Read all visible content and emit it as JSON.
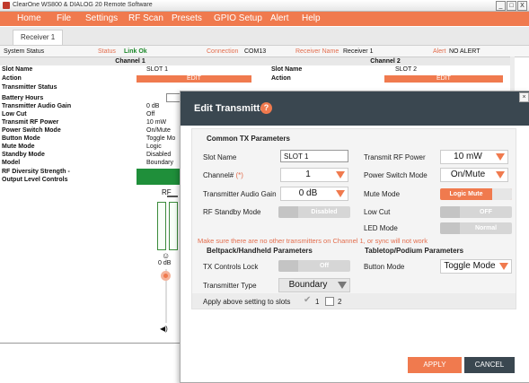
{
  "window": {
    "title": "ClearOne WS800 & DIALOG 20 Remote Software",
    "minimize": "_",
    "maximize": "□",
    "close": "X"
  },
  "menu": [
    "Home",
    "File",
    "Settings",
    "RF Scan",
    "Presets",
    "GPIO Setup",
    "Alert",
    "Help"
  ],
  "tab": "Receiver 1",
  "status": {
    "system_label": "System Status",
    "status_label": "Status",
    "status_value": "Link Ok",
    "connection_label": "Connection",
    "connection_value": "COM13",
    "receiver_name_label": "Receiver Name",
    "receiver_name_value": "Receiver 1",
    "alert_label": "Alert",
    "alert_value": "NO ALERT"
  },
  "channels": {
    "ch1": "Channel 1",
    "ch2": "Channel 2",
    "slot_name_label": "Slot Name",
    "action_label": "Action",
    "ch1_slot": "SLOT 1",
    "ch2_slot": "SLOT 2",
    "edit": "EDIT",
    "rows": [
      "Slot Name",
      "Action",
      "Transmitter Status",
      "Battery Hours",
      "Transmitter Audio Gain",
      "Low Cut",
      "Transmit RF Power",
      "Power Switch Mode",
      "Button Mode",
      "Mute Mode",
      "Standby Mode",
      "Model",
      "RF Diversity Strength -",
      "Output Level Controls"
    ],
    "values": [
      "0 dB",
      "Off",
      "10 mW",
      "On/Mute",
      "Toggle Mo",
      "Logic",
      "Disabled",
      "Boundary"
    ],
    "rf_label": "RF",
    "odb_label": "0 dB"
  },
  "dialog": {
    "title": "Edit Transmitter",
    "help": "?",
    "close": "×",
    "common_header": "Common TX Parameters",
    "slot_name_label": "Slot Name",
    "slot_name_value": "SLOT 1",
    "channel_label": "Channel#",
    "channel_required": "(*)",
    "channel_value": "1",
    "audio_gain_label": "Transmitter Audio Gain",
    "audio_gain_value": "0 dB",
    "rf_standby_label": "RF Standby Mode",
    "rf_standby_value": "Disabled",
    "rf_power_label": "Transmit RF Power",
    "rf_power_value": "10 mW",
    "power_switch_label": "Power Switch Mode",
    "power_switch_value": "On/Mute",
    "mute_mode_label": "Mute Mode",
    "mute_mode_value": "Logic Mute",
    "low_cut_label": "Low Cut",
    "low_cut_value": "OFF",
    "led_mode_label": "LED Mode",
    "led_mode_value": "Normal",
    "warning": "Make sure there are no other transmitters on Channel 1, or sync will not work",
    "beltpack_header": "Beltpack/Handheld Parameters",
    "tabletop_header": "Tabletop/Podium Parameters",
    "tx_lock_label": "TX Controls Lock",
    "tx_lock_value": "Off",
    "tx_type_label": "Transmitter Type",
    "tx_type_value": "Boundary",
    "button_mode_label": "Button Mode",
    "button_mode_value": "Toggle Mode",
    "apply_slots_label": "Apply above setting to slots",
    "slot1": "1",
    "slot2": "2",
    "apply_button": "APPLY",
    "cancel_button": "CANCEL"
  },
  "colors": {
    "accent": "#f07a4e",
    "header_dark": "#3a4750",
    "link_ok": "#1e8a2c"
  }
}
